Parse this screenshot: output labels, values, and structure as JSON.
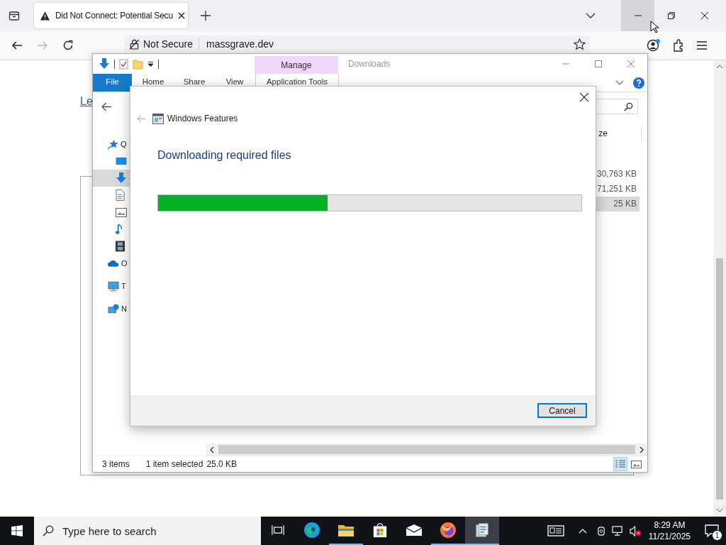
{
  "browser": {
    "tab": {
      "title": "Did Not Connect: Potential Secu"
    },
    "toolbar": {
      "forward_disabled": true,
      "security": "Not Secure",
      "url": "massgrave.dev"
    },
    "page": {
      "link": "Le"
    }
  },
  "explorer": {
    "title": "Downloads",
    "context_tab": "Manage",
    "ribbon_tabs": [
      {
        "label": "File",
        "kind": "file"
      },
      {
        "label": "Home",
        "kind": "plain"
      },
      {
        "label": "Share",
        "kind": "plain"
      },
      {
        "label": "View",
        "kind": "plain"
      },
      {
        "label": "Application Tools",
        "kind": "context"
      }
    ],
    "nav": [
      {
        "label": "Q",
        "kind": "star",
        "selected": false,
        "children": [
          {
            "kind": "desktop",
            "selected": false
          },
          {
            "kind": "download",
            "selected": true
          },
          {
            "kind": "document",
            "selected": false
          },
          {
            "kind": "pictures",
            "selected": false
          },
          {
            "kind": "music",
            "selected": false
          },
          {
            "kind": "video",
            "selected": false
          }
        ]
      },
      {
        "label": "O",
        "kind": "cloud",
        "selected": false
      },
      {
        "label": "T",
        "kind": "monitor",
        "selected": false
      },
      {
        "label": "N",
        "kind": "network",
        "selected": false
      }
    ],
    "column_header": "ze",
    "files": [
      {
        "size": "30,763 KB",
        "selected": false
      },
      {
        "size": "71,251 KB",
        "selected": false
      },
      {
        "size": "25 KB",
        "selected": true
      }
    ],
    "status_bar": {
      "count": "3 items",
      "selection": "1 item selected",
      "size": "25.0 KB"
    },
    "view_buttons": [
      {
        "kind": "details",
        "selected": true
      },
      {
        "kind": "thumbnails",
        "selected": false
      }
    ]
  },
  "dialog": {
    "title": "Windows Features",
    "heading": "Downloading required files",
    "progress": {
      "level": 0.4
    },
    "cancel": "Cancel"
  },
  "taskbar": {
    "search_placeholder": "Type here to search",
    "apps": [
      {
        "kind": "task-view",
        "running": false,
        "active": false
      },
      {
        "kind": "edge",
        "running": false,
        "active": false
      },
      {
        "kind": "folder",
        "running": true,
        "active": false
      },
      {
        "kind": "store",
        "running": false,
        "active": false
      },
      {
        "kind": "mail",
        "running": false,
        "active": false
      },
      {
        "kind": "firefox",
        "running": true,
        "active": false
      },
      {
        "kind": "features",
        "running": true,
        "active": true
      }
    ],
    "time": "8:29 AM",
    "date": "11/21/2025",
    "notifications": "1"
  }
}
